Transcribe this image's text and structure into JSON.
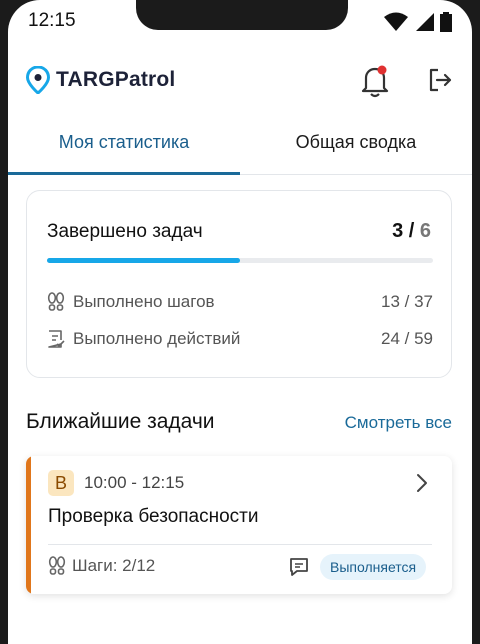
{
  "status_bar": {
    "time": "12:15",
    "icons": [
      "wifi-icon",
      "signal-icon",
      "battery-icon"
    ]
  },
  "header": {
    "app_name": "TARGPatrol",
    "logo_icon": "location-pin-icon",
    "notification_icon": "bell-icon",
    "logout_icon": "logout-icon",
    "notification_dot_color": "#e03131",
    "brand_color": "#17a7e8"
  },
  "tabs": [
    {
      "label": "Моя статистика",
      "active": true
    },
    {
      "label": "Общая сводка",
      "active": false
    }
  ],
  "stats": {
    "title": "Завершено задач",
    "completed": "3",
    "separator": " / ",
    "total": "6",
    "progress_fraction": 0.5,
    "rows": [
      {
        "icon": "footsteps-icon",
        "label": "Выполнено шагов",
        "value": "13 / 37"
      },
      {
        "icon": "checklist-icon",
        "label": "Выполнено действий",
        "value": "24 / 59"
      }
    ]
  },
  "upcoming": {
    "title": "Ближайшие задачи",
    "see_all": "Смотреть все",
    "tasks": [
      {
        "badge": "В",
        "time": "10:00 - 12:15",
        "name": "Проверка безопасности",
        "steps": "Шаги: 2/12",
        "status": "Выполняется",
        "accent_color": "#e0761b"
      }
    ]
  }
}
